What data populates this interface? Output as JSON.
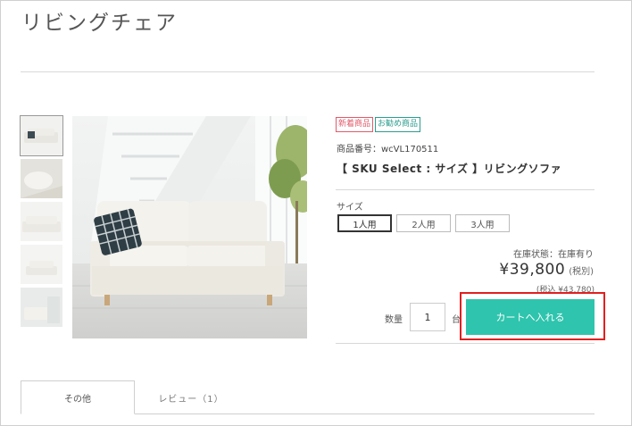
{
  "page": {
    "title": "リビングチェア"
  },
  "product": {
    "badges": {
      "new": "新着商品",
      "recommended": "お勧め商品"
    },
    "sku": "商品番号：wcVL170511",
    "name": "【 SKU Select : サイズ 】リビングソファ",
    "size_label": "サイズ",
    "sizes": [
      "1人用",
      "2人用",
      "3人用"
    ],
    "selected_size": "1人用",
    "stock": "在庫状態：在庫有り",
    "price": "¥39,800",
    "tax_note": "(税別)",
    "tax_included": "(税込 ¥43,780)",
    "quantity_label": "数量",
    "quantity": "1",
    "quantity_unit": "台",
    "cart_button": "カートへ入れる"
  },
  "tabs": {
    "active": "その他",
    "review": "レビュー（1）"
  },
  "colors": {
    "accent": "#2ec4ad",
    "highlight": "#e02020",
    "new_badge": "#e05a6b",
    "recommended_badge": "#2a9d8f"
  },
  "icons": [
    "sofa-product-photo",
    "sofa-thumbnail"
  ]
}
